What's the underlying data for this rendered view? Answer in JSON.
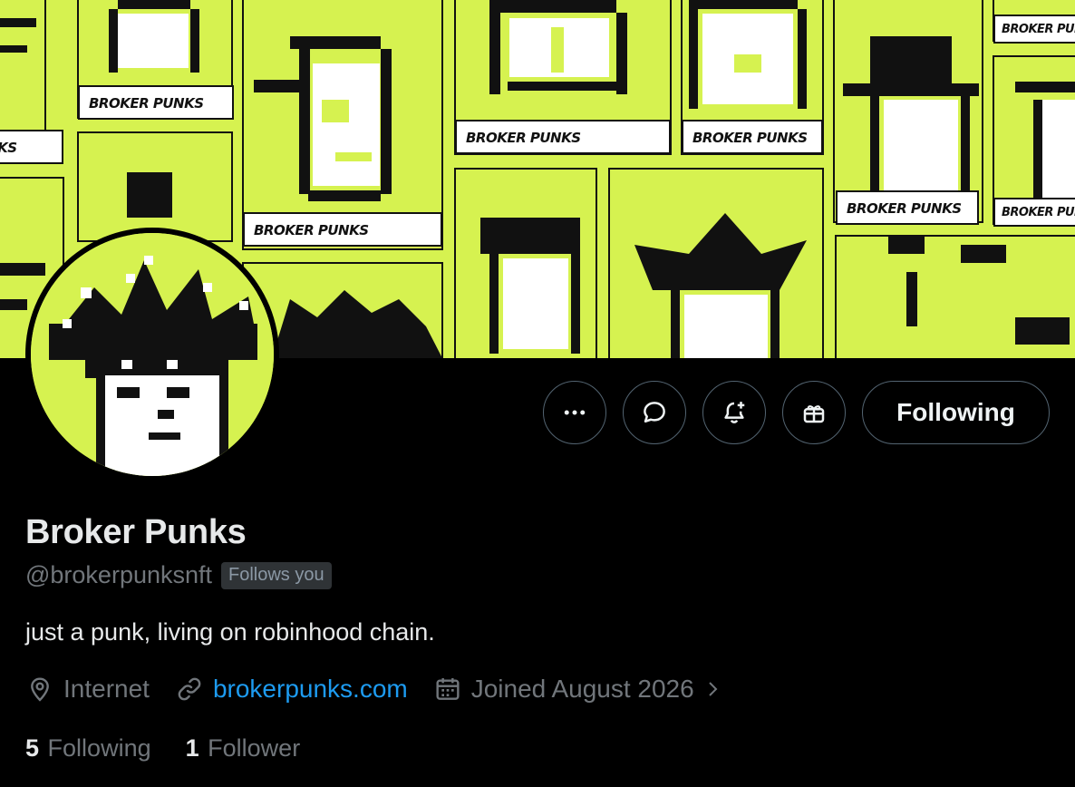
{
  "banner": {
    "card_labels": [
      "BROKER PUNKS",
      "BROKER PUNKS",
      "BROKER PUNKS",
      "BROKER PUNKS",
      "BROKER PUNKS",
      "BROKER PUNKS",
      "BROKER PUNKS",
      "BROKER PUNKS"
    ],
    "background_color": "#d6f250"
  },
  "actions": {
    "more_icon": "more-dots-icon",
    "message_icon": "message-bubble-icon",
    "notify_icon": "bell-plus-icon",
    "gift_icon": "gift-icon",
    "following_label": "Following"
  },
  "profile": {
    "display_name": "Broker Punks",
    "handle": "@brokerpunksnft",
    "follows_you": "Follows you",
    "bio": "just a punk, living on robinhood chain.",
    "location": "Internet",
    "website": "brokerpunks.com",
    "joined": "Joined August 2026",
    "following_count": "5",
    "following_label": "Following",
    "followers_count": "1",
    "followers_label": "Follower"
  },
  "colors": {
    "accent_link": "#1d9bf0",
    "secondary_text": "#71767b",
    "button_border": "#536471"
  }
}
